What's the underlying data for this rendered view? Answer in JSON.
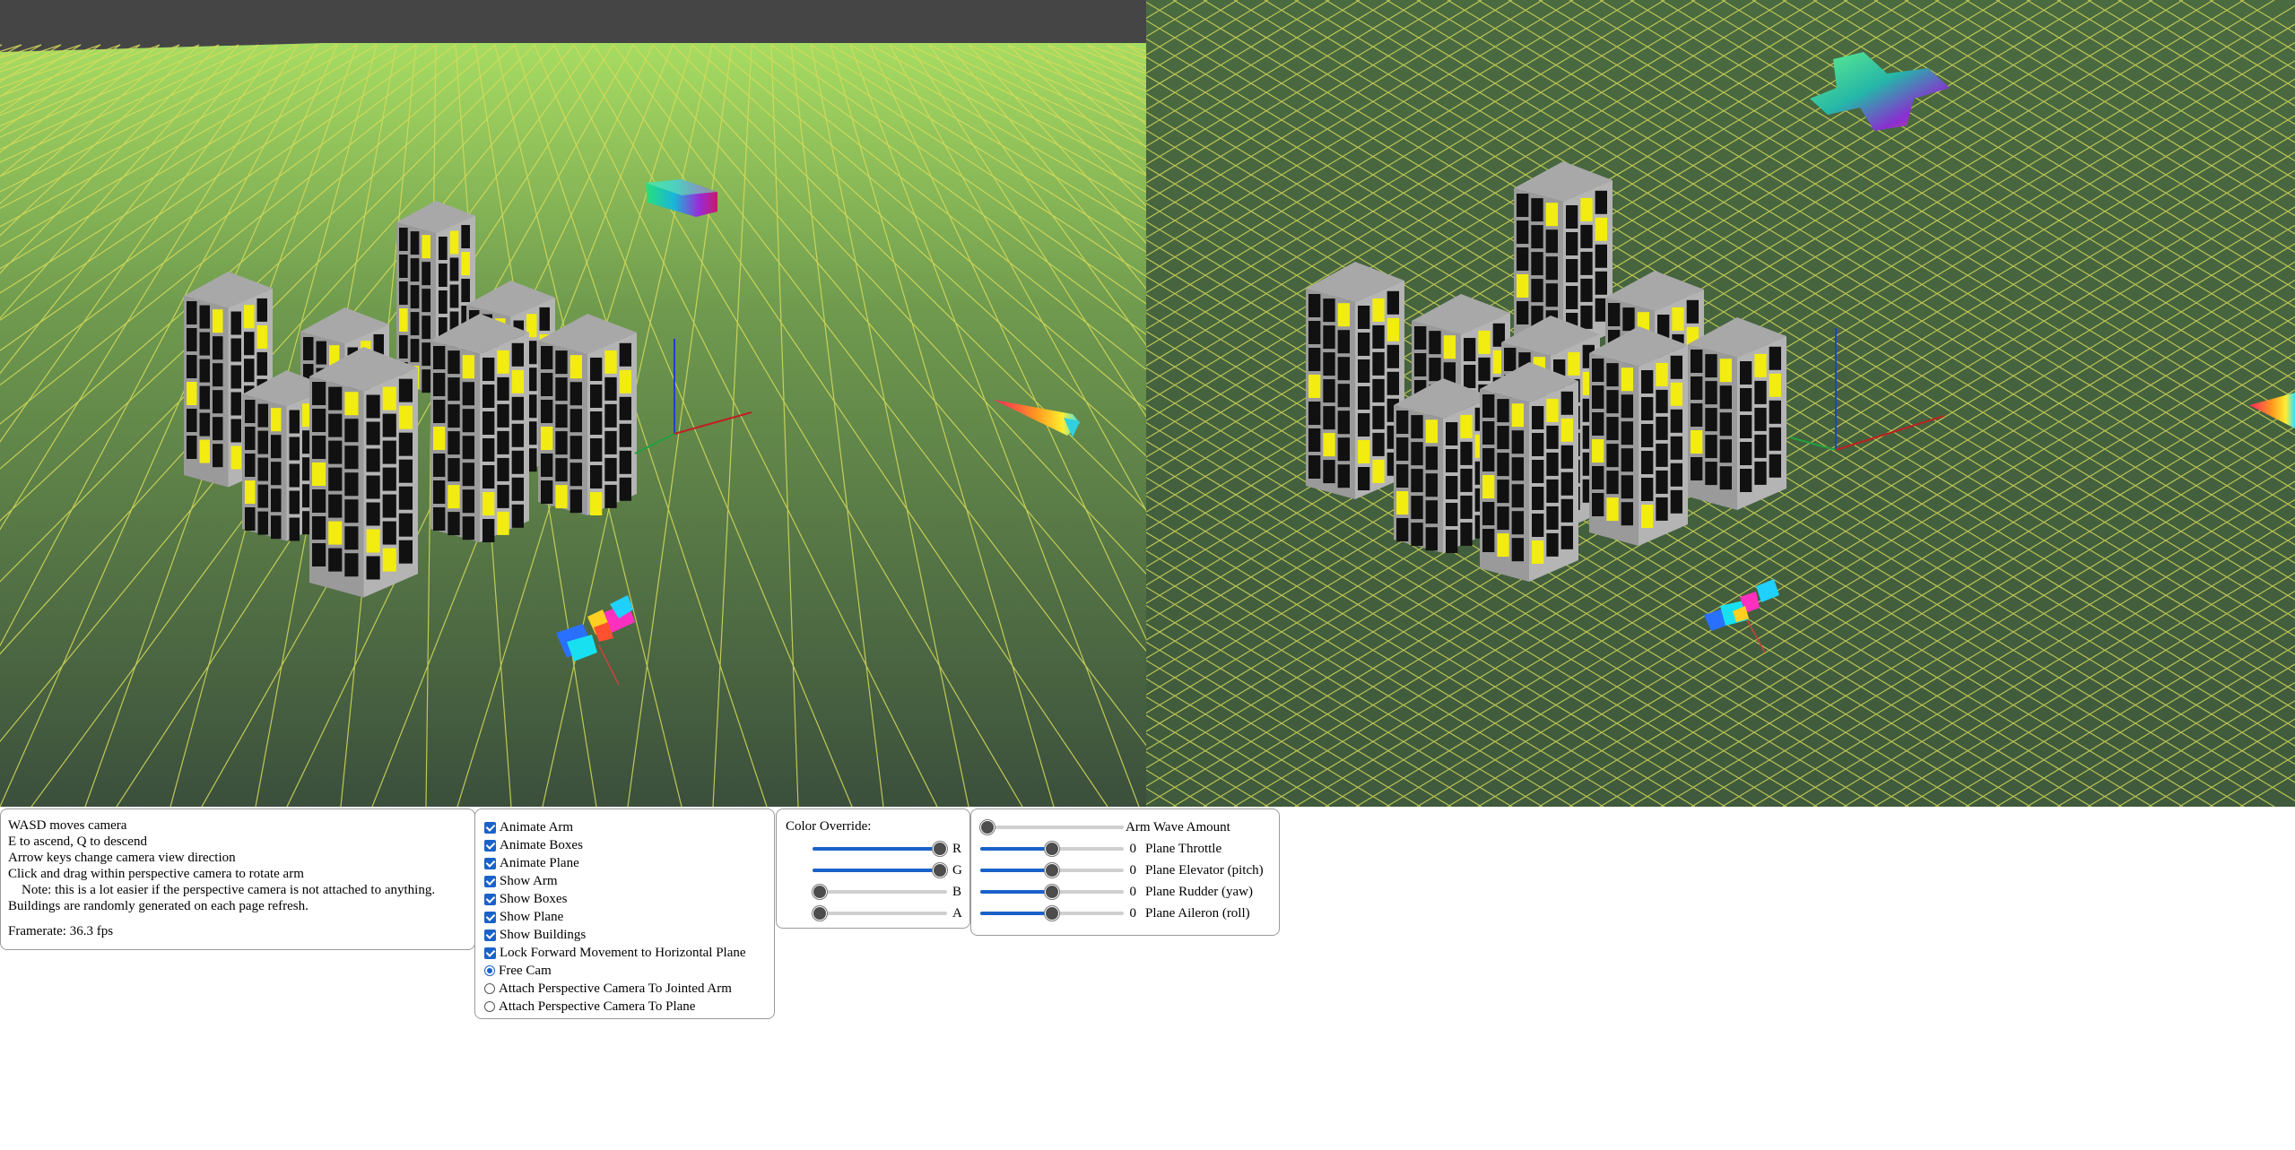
{
  "help": {
    "lines": [
      "WASD moves camera",
      "E to ascend, Q to descend",
      "Arrow keys change camera view direction",
      "Click and drag within perspective camera to rotate arm",
      "    Note: this is a lot easier if the perspective camera is not attached to anything.",
      "Buildings are randomly generated on each page refresh."
    ],
    "framerate": "Framerate: 36.3 fps"
  },
  "toggles": {
    "checkboxes": [
      {
        "label": "Animate Arm",
        "checked": true
      },
      {
        "label": "Animate Boxes",
        "checked": true
      },
      {
        "label": "Animate Plane",
        "checked": true
      },
      {
        "label": "Show Arm",
        "checked": true
      },
      {
        "label": "Show Boxes",
        "checked": true
      },
      {
        "label": "Show Plane",
        "checked": true
      },
      {
        "label": "Show Buildings",
        "checked": true
      },
      {
        "label": "Lock Forward Movement to Horizontal Plane",
        "checked": true
      }
    ],
    "radios": [
      {
        "label": "Free Cam",
        "selected": true
      },
      {
        "label": "Attach Perspective Camera To Jointed Arm",
        "selected": false
      },
      {
        "label": "Attach Perspective Camera To Plane",
        "selected": false
      }
    ]
  },
  "color_override": {
    "title": "Color Override:",
    "channels": [
      {
        "label": "R",
        "value": 1.0
      },
      {
        "label": "G",
        "value": 1.0
      },
      {
        "label": "B",
        "value": 0.0
      },
      {
        "label": "A",
        "value": 0.0
      }
    ]
  },
  "plane_controls": {
    "arm_wave": {
      "label": "Arm Wave Amount",
      "value": 0.0
    },
    "sliders": [
      {
        "label": "Plane Throttle",
        "display": "0",
        "value": 0.5
      },
      {
        "label": "Plane Elevator (pitch)",
        "display": "0",
        "value": 0.5
      },
      {
        "label": "Plane Rudder (yaw)",
        "display": "0",
        "value": 0.5
      },
      {
        "label": "Plane Aileron (roll)",
        "display": "0",
        "value": 0.5
      }
    ]
  },
  "colors": {
    "background": "#454545",
    "grid_line": "#d8dc5a",
    "ground_near": "#3e5a3c",
    "ground_far": "#9ed25e",
    "building": "#111111",
    "window_lit": "#f2ec10",
    "accent": "#1a62c9"
  }
}
